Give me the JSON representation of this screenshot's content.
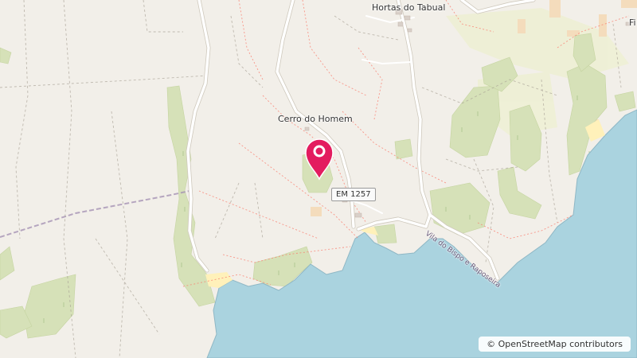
{
  "map": {
    "colors": {
      "land": "#f2efe9",
      "sea": "#aad3df",
      "scrub": "#d6e1b8",
      "farmland": "#eef0d5",
      "road": "#ffffff",
      "marker": "#e31c5f"
    },
    "labels": {
      "top_village": "Hortas do Tabual",
      "center_place": "Cerro do Homem",
      "edge_place": "Fi"
    },
    "road_ref": "EM 1257",
    "road_name": "Vila do Bispo e Raposeira",
    "marker": {
      "icon": "map-pin-icon"
    },
    "attribution": "© OpenStreetMap contributors"
  }
}
